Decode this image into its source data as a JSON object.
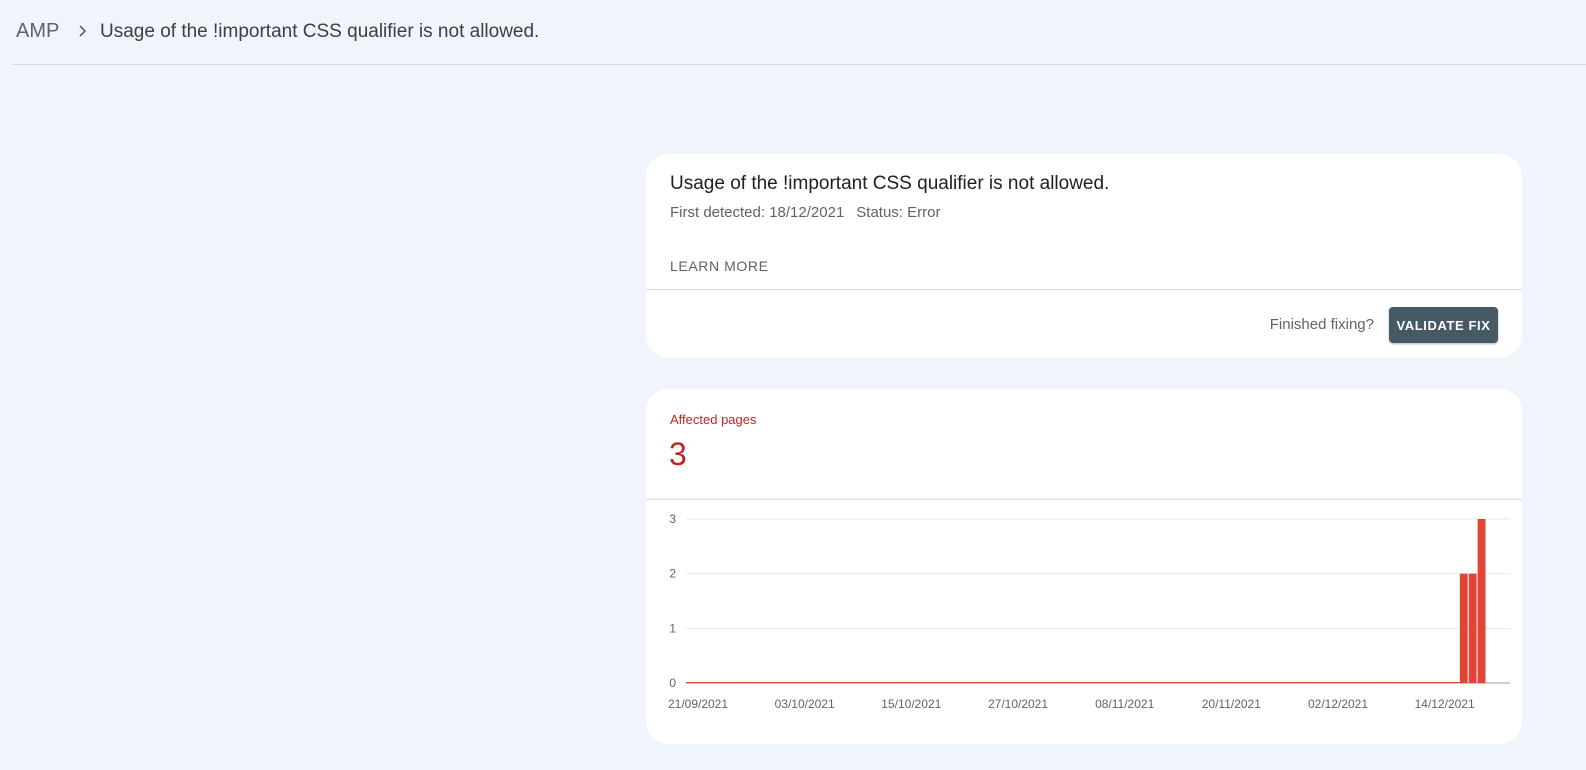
{
  "breadcrumb": {
    "root": "AMP",
    "title": "Usage of the !important CSS qualifier is not allowed."
  },
  "issue_card": {
    "title": "Usage of the !important CSS qualifier is not allowed.",
    "first_detected": "First detected: 18/12/2021",
    "status": "Status: Error",
    "learn_more": "LEARN MORE",
    "finished_fixing": "Finished fixing?",
    "validate_button": "VALIDATE FIX"
  },
  "chart_card": {
    "label": "Affected pages",
    "count": "3"
  },
  "colors": {
    "accent_red": "#c5221f",
    "bar_red": "#e04434",
    "button": "#455a64",
    "background": "#f0f4fb"
  },
  "chart_data": {
    "type": "bar",
    "title": "",
    "xlabel": "",
    "ylabel": "",
    "ylim": [
      0,
      3
    ],
    "yticks": [
      0,
      1,
      2,
      3
    ],
    "x_start": "21/09/2021",
    "x_end": "19/12/2021",
    "x_tick_labels": [
      "21/09/2021",
      "03/10/2021",
      "15/10/2021",
      "27/10/2021",
      "08/11/2021",
      "20/11/2021",
      "02/12/2021",
      "14/12/2021"
    ],
    "categories": [
      "21/09/2021",
      "22/09/2021",
      "23/09/2021",
      "24/09/2021",
      "25/09/2021",
      "26/09/2021",
      "27/09/2021",
      "28/09/2021",
      "29/09/2021",
      "30/09/2021",
      "01/10/2021",
      "02/10/2021",
      "03/10/2021",
      "04/10/2021",
      "05/10/2021",
      "06/10/2021",
      "07/10/2021",
      "08/10/2021",
      "09/10/2021",
      "10/10/2021",
      "11/10/2021",
      "12/10/2021",
      "13/10/2021",
      "14/10/2021",
      "15/10/2021",
      "16/10/2021",
      "17/10/2021",
      "18/10/2021",
      "19/10/2021",
      "20/10/2021",
      "21/10/2021",
      "22/10/2021",
      "23/10/2021",
      "24/10/2021",
      "25/10/2021",
      "26/10/2021",
      "27/10/2021",
      "28/10/2021",
      "29/10/2021",
      "30/10/2021",
      "31/10/2021",
      "01/11/2021",
      "02/11/2021",
      "03/11/2021",
      "04/11/2021",
      "05/11/2021",
      "06/11/2021",
      "07/11/2021",
      "08/11/2021",
      "09/11/2021",
      "10/11/2021",
      "11/11/2021",
      "12/11/2021",
      "13/11/2021",
      "14/11/2021",
      "15/11/2021",
      "16/11/2021",
      "17/11/2021",
      "18/11/2021",
      "19/11/2021",
      "20/11/2021",
      "21/11/2021",
      "22/11/2021",
      "23/11/2021",
      "24/11/2021",
      "25/11/2021",
      "26/11/2021",
      "27/11/2021",
      "28/11/2021",
      "29/11/2021",
      "30/11/2021",
      "01/12/2021",
      "02/12/2021",
      "03/12/2021",
      "04/12/2021",
      "05/12/2021",
      "06/12/2021",
      "07/12/2021",
      "08/12/2021",
      "09/12/2021",
      "10/12/2021",
      "11/12/2021",
      "12/12/2021",
      "13/12/2021",
      "14/12/2021",
      "15/12/2021",
      "16/12/2021",
      "17/12/2021",
      "18/12/2021",
      "19/12/2021"
    ],
    "values": [
      0,
      0,
      0,
      0,
      0,
      0,
      0,
      0,
      0,
      0,
      0,
      0,
      0,
      0,
      0,
      0,
      0,
      0,
      0,
      0,
      0,
      0,
      0,
      0,
      0,
      0,
      0,
      0,
      0,
      0,
      0,
      0,
      0,
      0,
      0,
      0,
      0,
      0,
      0,
      0,
      0,
      0,
      0,
      0,
      0,
      0,
      0,
      0,
      0,
      0,
      0,
      0,
      0,
      0,
      0,
      0,
      0,
      0,
      0,
      0,
      0,
      0,
      0,
      0,
      0,
      0,
      0,
      0,
      0,
      0,
      0,
      0,
      0,
      0,
      0,
      0,
      0,
      0,
      0,
      0,
      0,
      0,
      0,
      0,
      0,
      0,
      0,
      2,
      2,
      3
    ],
    "grid": true,
    "bar_color": "#e04434"
  }
}
